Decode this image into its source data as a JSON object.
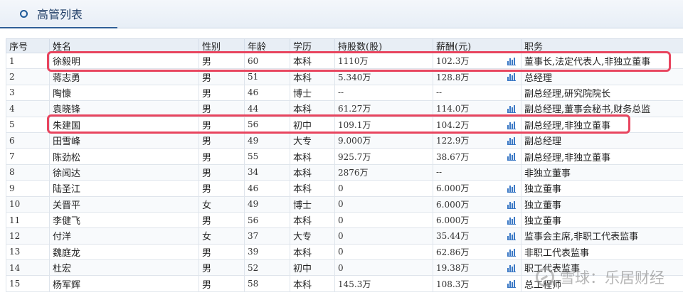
{
  "header": {
    "title": "高管列表"
  },
  "table": {
    "columns": [
      "序号",
      "姓名",
      "性别",
      "年龄",
      "学历",
      "持股数(股)",
      "薪酬(元)",
      "职务"
    ],
    "rows": [
      {
        "idx": "1",
        "name": "徐毅明",
        "gender": "男",
        "age": "60",
        "edu": "本科",
        "shares": "1110万",
        "salary": "102.3万",
        "chart": true,
        "position": "董事长,法定代表人,非独立董事"
      },
      {
        "idx": "2",
        "name": "蒋志勇",
        "gender": "男",
        "age": "51",
        "edu": "本科",
        "shares": "5.340万",
        "salary": "128.8万",
        "chart": true,
        "position": "总经理"
      },
      {
        "idx": "3",
        "name": "陶慷",
        "gender": "男",
        "age": "46",
        "edu": "博士",
        "shares": "--",
        "salary": "--",
        "chart": false,
        "position": "副总经理,研究院院长"
      },
      {
        "idx": "4",
        "name": "袁晓锋",
        "gender": "男",
        "age": "44",
        "edu": "本科",
        "shares": "61.27万",
        "salary": "114.0万",
        "chart": true,
        "position": "副总经理,董事会秘书,财务总监"
      },
      {
        "idx": "5",
        "name": "朱建国",
        "gender": "男",
        "age": "56",
        "edu": "初中",
        "shares": "109.1万",
        "salary": "104.2万",
        "chart": true,
        "position": "副总经理,非独立董事"
      },
      {
        "idx": "6",
        "name": "田雪峰",
        "gender": "男",
        "age": "49",
        "edu": "大专",
        "shares": "9.000万",
        "salary": "122.9万",
        "chart": true,
        "position": "副总经理"
      },
      {
        "idx": "7",
        "name": "陈劲松",
        "gender": "男",
        "age": "55",
        "edu": "本科",
        "shares": "925.7万",
        "salary": "38.67万",
        "chart": true,
        "position": "副总经理,非独立董事"
      },
      {
        "idx": "8",
        "name": "徐闻达",
        "gender": "男",
        "age": "34",
        "edu": "本科",
        "shares": "2876万",
        "salary": "--",
        "chart": false,
        "position": "非独立董事"
      },
      {
        "idx": "9",
        "name": "陆圣江",
        "gender": "男",
        "age": "46",
        "edu": "本科",
        "shares": "0",
        "salary": "6.000万",
        "chart": true,
        "position": "独立董事"
      },
      {
        "idx": "10",
        "name": "关晋平",
        "gender": "女",
        "age": "49",
        "edu": "博士",
        "shares": "0",
        "salary": "6.000万",
        "chart": true,
        "position": "独立董事"
      },
      {
        "idx": "11",
        "name": "李健飞",
        "gender": "男",
        "age": "56",
        "edu": "本科",
        "shares": "0",
        "salary": "6.000万",
        "chart": true,
        "position": "独立董事"
      },
      {
        "idx": "12",
        "name": "付洋",
        "gender": "女",
        "age": "37",
        "edu": "大专",
        "shares": "0",
        "salary": "35.44万",
        "chart": true,
        "position": "监事会主席,非职工代表监事"
      },
      {
        "idx": "13",
        "name": "魏庭龙",
        "gender": "男",
        "age": "39",
        "edu": "本科",
        "shares": "0",
        "salary": "62.86万",
        "chart": true,
        "position": "非职工代表监事"
      },
      {
        "idx": "14",
        "name": "杜宏",
        "gender": "男",
        "age": "52",
        "edu": "初中",
        "shares": "0",
        "salary": "19.38万",
        "chart": true,
        "position": "职工代表监事"
      },
      {
        "idx": "15",
        "name": "杨军辉",
        "gender": "男",
        "age": "58",
        "edu": "本科",
        "shares": "145.3万",
        "salary": "108.3万",
        "chart": true,
        "position": "总工程师"
      }
    ]
  },
  "watermark": {
    "text": "雪球：乐居财经"
  },
  "colors": {
    "highlight": "#e8455f",
    "accent": "#1e5a99",
    "chart_icon": "#3a78c5"
  }
}
